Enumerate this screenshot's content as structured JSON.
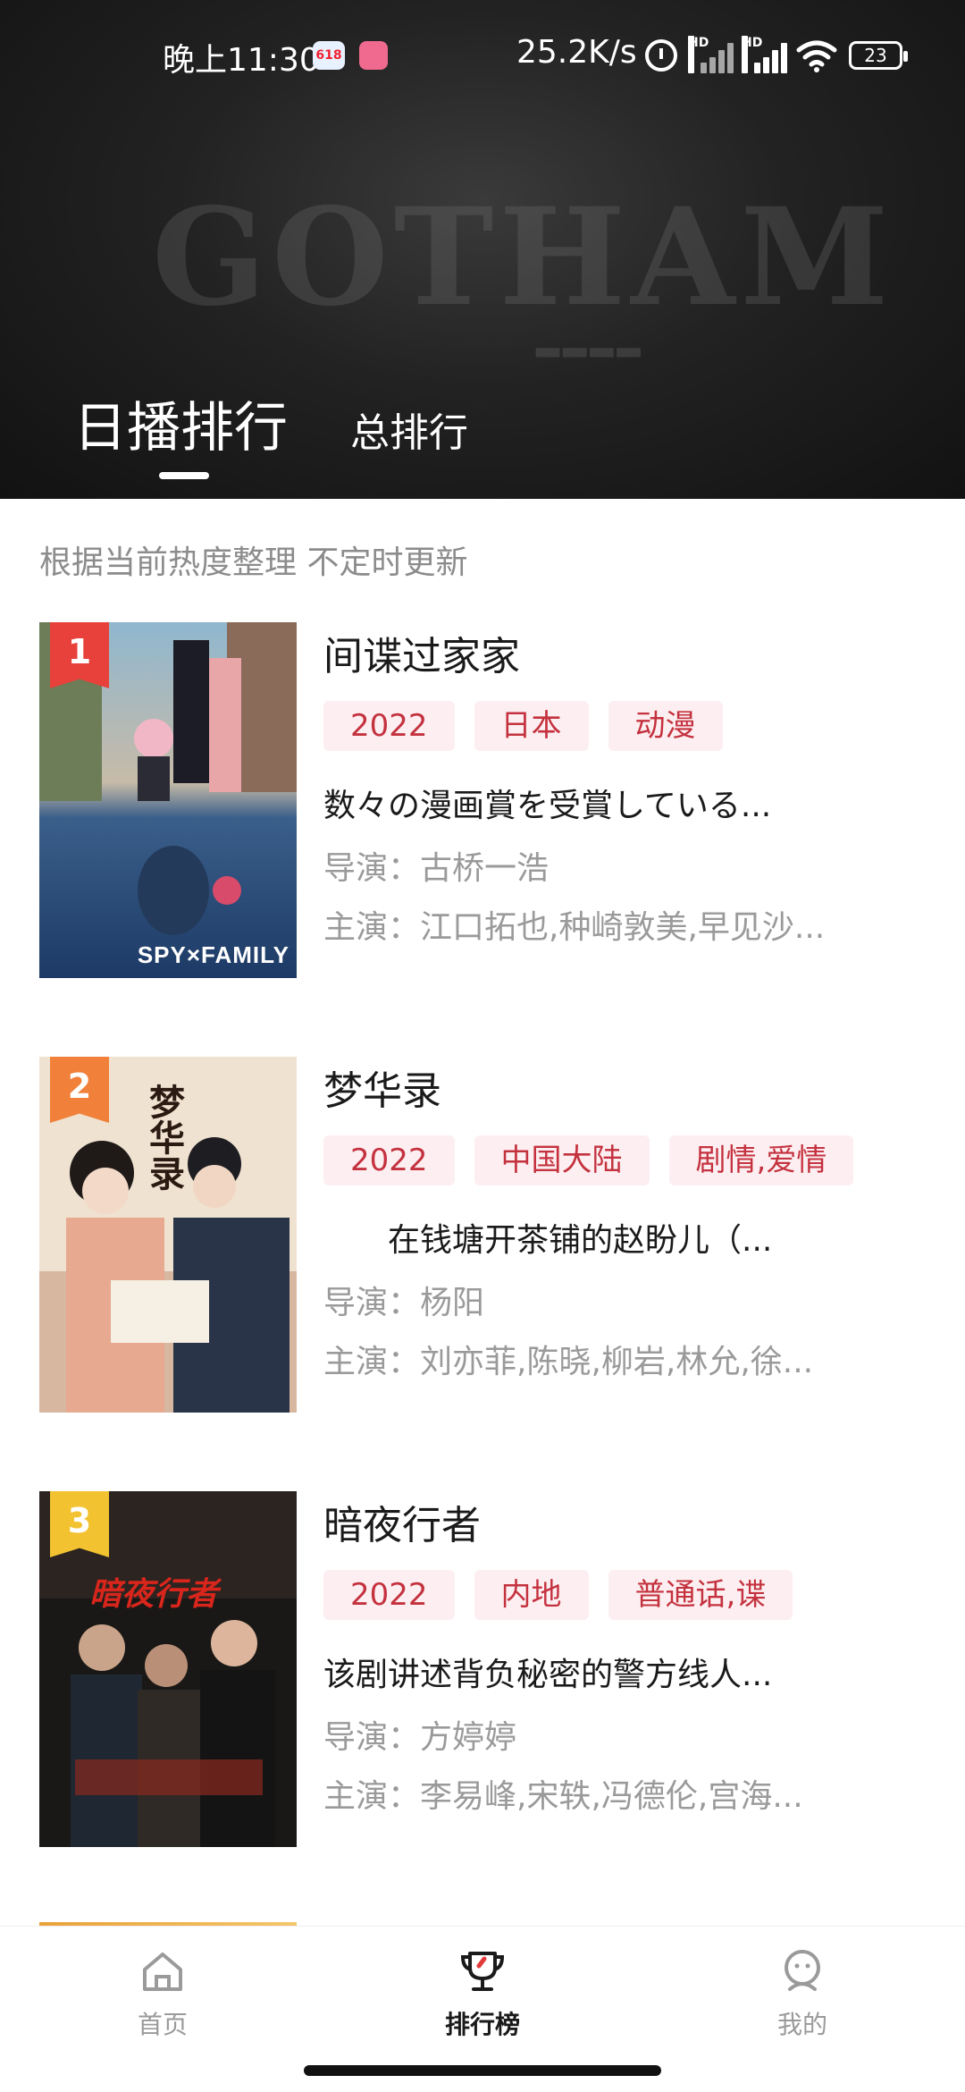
{
  "status_bar": {
    "time": "晚上11:30",
    "badge_618": "618",
    "net_speed": "25.2K/s",
    "hd_label": "HD",
    "battery": "23",
    "icons": [
      "alarm-icon",
      "signal-icon",
      "signal-icon",
      "wifi-icon",
      "battery-icon"
    ]
  },
  "header": {
    "background_text": "GOTHAM",
    "tab_active": "日播排行",
    "tab_inactive": "总排行"
  },
  "subtitle": "根据当前热度整理 不定时更新",
  "items": [
    {
      "rank": "1",
      "rank_color": "#e8403a",
      "poster_caption": "SPY×FAMILY",
      "title": "间谍过家家",
      "tags": [
        "2022",
        "日本",
        "动漫"
      ],
      "desc": "数々の漫画賞を受賞している...",
      "director": "导演：古桥一浩",
      "cast": "主演：江口拓也,种崎敦美,早见沙..."
    },
    {
      "rank": "2",
      "rank_color": "#f0803a",
      "poster_caption": "梦华录",
      "title": "梦华录",
      "tags": [
        "2022",
        "中国大陆",
        "剧情,爱情"
      ],
      "desc": "　　在钱塘开茶铺的赵盼儿（...",
      "director": "导演：杨阳",
      "cast": "主演：刘亦菲,陈晓,柳岩,林允,徐..."
    },
    {
      "rank": "3",
      "rank_color": "#f2c230",
      "poster_caption": "暗夜行者",
      "title": "暗夜行者",
      "tags": [
        "2022",
        "内地",
        "普通话,谍"
      ],
      "desc": "该剧讲述背负秘密的警方线人...",
      "director": "导演：方婷婷",
      "cast": "主演：李易峰,宋轶,冯德伦,宫海..."
    }
  ],
  "bottom_nav": [
    {
      "label": "首页",
      "icon": "home-icon",
      "active": false
    },
    {
      "label": "排行榜",
      "icon": "trophy-icon",
      "active": true
    },
    {
      "label": "我的",
      "icon": "profile-icon",
      "active": false
    }
  ]
}
